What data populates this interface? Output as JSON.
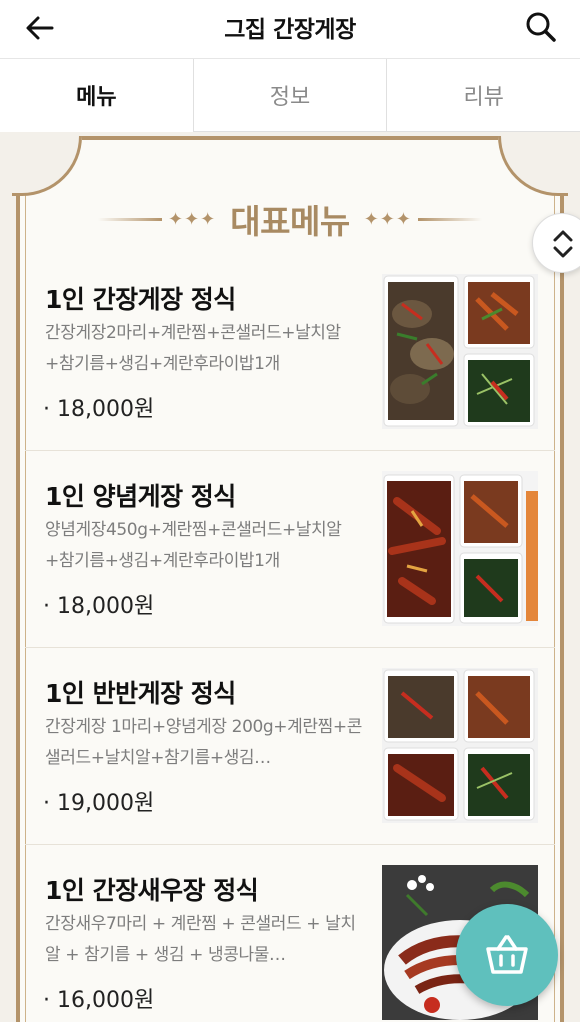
{
  "header": {
    "title": "그집 간장게장",
    "back_icon": "arrow-left-icon",
    "search_icon": "search-icon"
  },
  "tabs": [
    {
      "label": "메뉴",
      "active": true
    },
    {
      "label": "정보",
      "active": false
    },
    {
      "label": "리뷰",
      "active": false
    }
  ],
  "section": {
    "title": "대표메뉴",
    "ornament": "✦✦✦"
  },
  "menu_items": [
    {
      "name": "1인 간장게장 정식",
      "description": "간장게장2마리+계란찜+콘샐러드+날치알+참기름+생김+계란후라이밥1개",
      "price": "· 18,000원"
    },
    {
      "name": "1인 양념게장 정식",
      "description": "양념게장450g+계란찜+콘샐러드+날치알+참기름+생김+계란후라이밥1개",
      "price": "· 18,000원"
    },
    {
      "name": "1인 반반게장 정식",
      "description": "간장게장 1마리+양념게장 200g+계란찜+콘샐러드+날치알+참기름+생김…",
      "price": "· 19,000원"
    },
    {
      "name": "1인 간장새우장 정식",
      "description": "간장새우7마리 + 계란찜 + 콘샐러드 + 날치알 + 참기름 + 생김 + 냉콩나물…",
      "price": "· 16,000원"
    }
  ],
  "floating": {
    "scroll_icon": "chevron-up-down-icon",
    "cart_icon": "basket-icon"
  },
  "colors": {
    "accent_gold": "#b3936a",
    "section_title": "#a88a62",
    "cart_fab": "#5fc0bd"
  }
}
